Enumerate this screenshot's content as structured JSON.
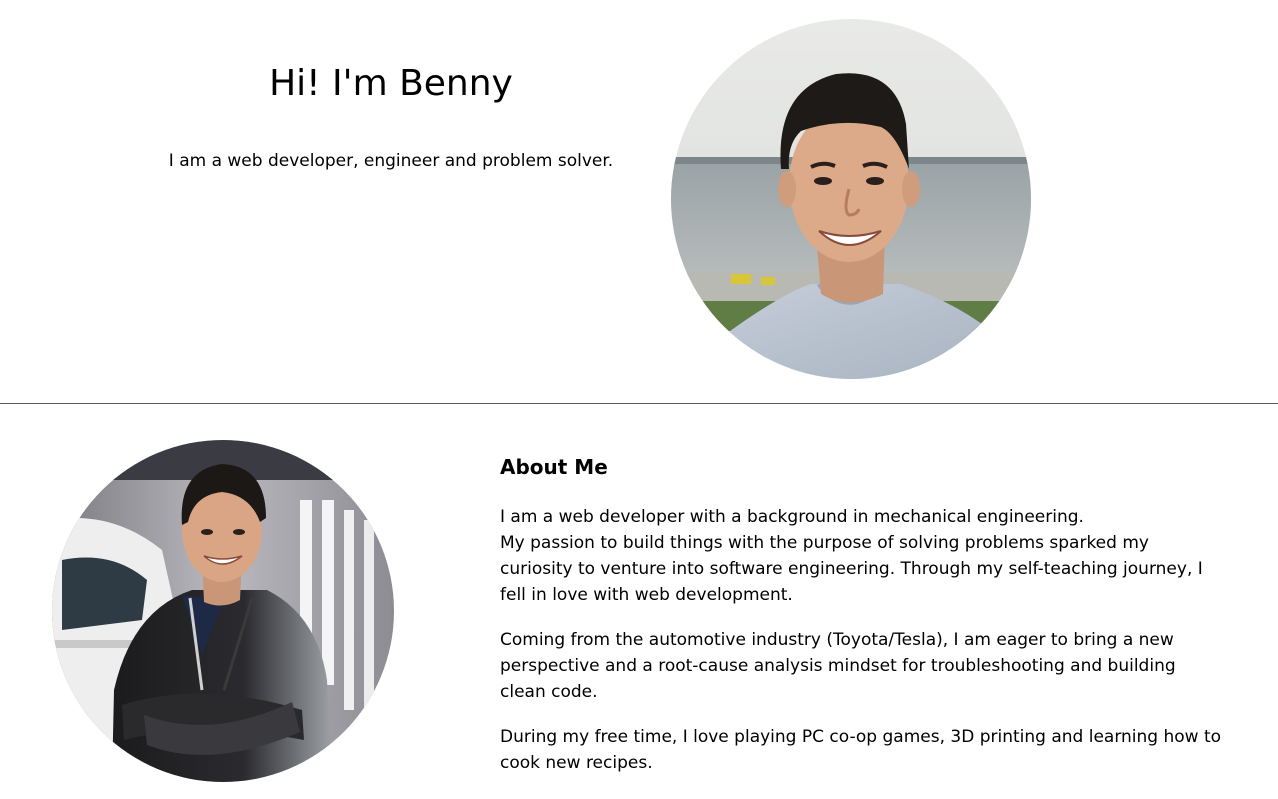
{
  "hero": {
    "title": "Hi! I'm Benny",
    "tagline": "I am a web developer, engineer and problem solver."
  },
  "about": {
    "heading": "About Me",
    "paragraphs": [
      {
        "lines": [
          "I am a web developer with a background in mechanical engineering.",
          "My passion to build things with the purpose of solving problems sparked my",
          "curiosity to venture into software engineering. Through my self-teaching journey, I",
          "fell in love with web development."
        ]
      },
      {
        "lines": [
          "Coming from the automotive industry (Toyota/Tesla), I am eager to bring a new",
          "perspective and a root-cause analysis mindset for troubleshooting and building",
          "clean code."
        ]
      },
      {
        "lines": [
          "During my free time, I love playing PC co-op games, 3D printing and learning how to",
          "cook new recipes."
        ]
      }
    ]
  },
  "colors": {
    "background": "#ffffff",
    "text": "#000000",
    "divider": "#5a5a5a"
  },
  "images": {
    "hero_portrait": "portrait-photo-lakeside",
    "about_portrait": "portrait-photo-garage"
  }
}
